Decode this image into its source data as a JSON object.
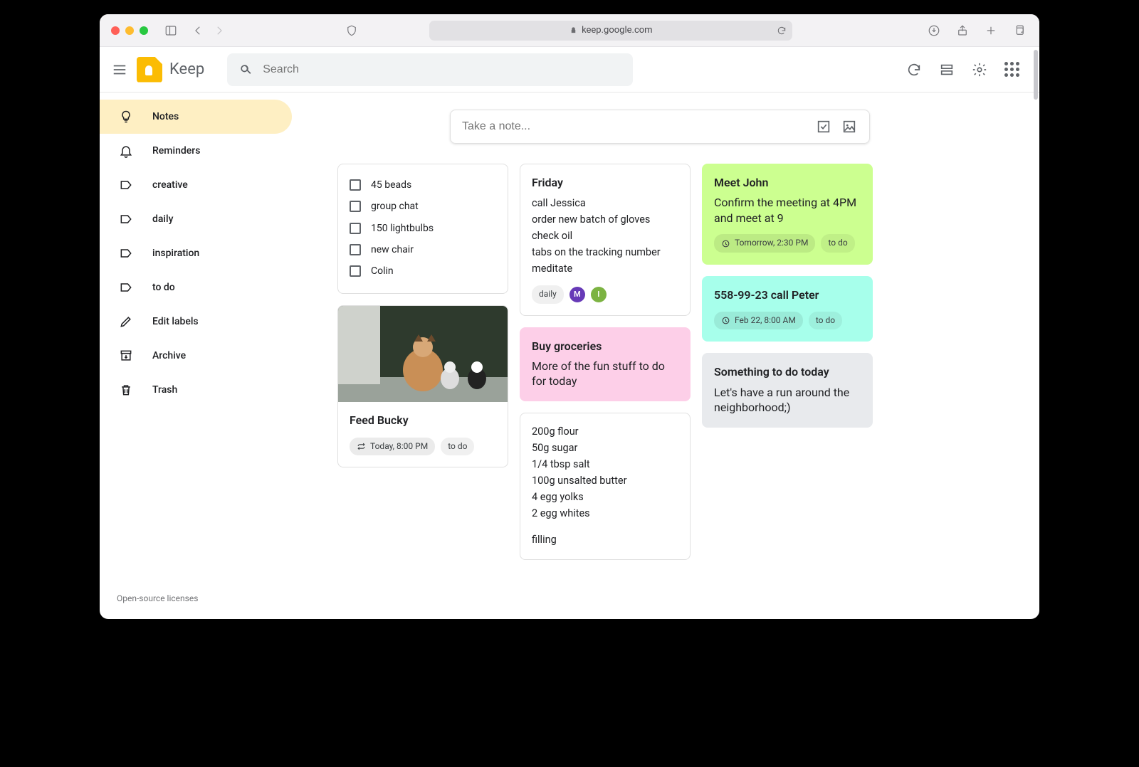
{
  "browser": {
    "url": "keep.google.com"
  },
  "app": {
    "title": "Keep",
    "search_placeholder": "Search"
  },
  "sidebar": {
    "items": [
      {
        "label": "Notes"
      },
      {
        "label": "Reminders"
      },
      {
        "label": "creative"
      },
      {
        "label": "daily"
      },
      {
        "label": "inspiration"
      },
      {
        "label": "to do"
      },
      {
        "label": "Edit labels"
      },
      {
        "label": "Archive"
      },
      {
        "label": "Trash"
      }
    ],
    "footer": "Open-source licenses"
  },
  "compose": {
    "placeholder": "Take a note..."
  },
  "notes": {
    "checklist": {
      "items": [
        "45 beads",
        "group chat",
        "150 lightbulbs",
        "new chair",
        "Colin"
      ]
    },
    "feed_bucky": {
      "title": "Feed Bucky",
      "reminder": "Today, 8:00 PM",
      "tag": "to do"
    },
    "friday": {
      "title": "Friday",
      "lines": [
        "call Jessica",
        "order new batch of gloves",
        "check oil",
        "tabs on the tracking number",
        "meditate"
      ],
      "tag": "daily",
      "collab1": "M",
      "collab2": "I"
    },
    "groceries": {
      "title": "Buy groceries",
      "body": "More of the fun stuff to do for today"
    },
    "recipe": {
      "lines": [
        "200g flour",
        "50g sugar",
        "1/4 tbsp salt",
        "100g unsalted butter",
        "4 egg yolks",
        "2 egg whites",
        "",
        "filling"
      ]
    },
    "meet_john": {
      "title": "Meet John",
      "body": "Confirm the meeting at 4PM and meet at 9",
      "reminder": "Tomorrow, 2:30 PM",
      "tag": "to do"
    },
    "call_peter": {
      "title": "558-99-23 call Peter",
      "reminder": "Feb 22, 8:00 AM",
      "tag": "to do"
    },
    "run": {
      "title": "Something to do today",
      "body": "Let's have a run around the neighborhood;)"
    }
  }
}
